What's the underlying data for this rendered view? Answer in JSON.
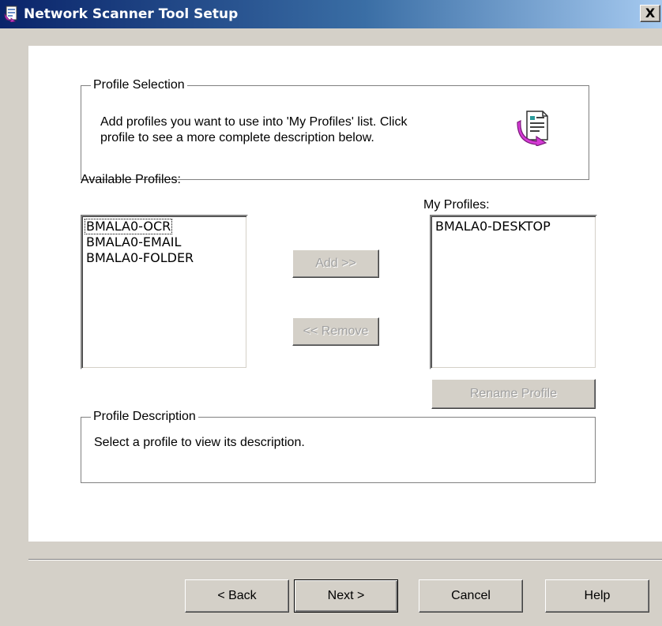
{
  "window": {
    "title": "Network Scanner Tool Setup",
    "title_icon": "setup-wizard-icon",
    "close_label": "X"
  },
  "profile_selection": {
    "legend": "Profile Selection",
    "description_line1": "Add profiles you want to use into 'My Profiles' list. Click",
    "description_line2": "profile to see a more complete description below.",
    "icon": "document-arrow-icon"
  },
  "available_profiles": {
    "label": "Available Profiles:",
    "items": [
      "BMALA0-OCR",
      "BMALA0-EMAIL",
      "BMALA0-FOLDER"
    ]
  },
  "my_profiles": {
    "label": "My Profiles:",
    "items": [
      "BMALA0-DESKTOP"
    ]
  },
  "buttons": {
    "add": "Add >>",
    "remove": "<< Remove",
    "rename": "Rename Profile",
    "back": "< Back",
    "next": "Next >",
    "cancel": "Cancel",
    "help": "Help"
  },
  "profile_description": {
    "legend": "Profile Description",
    "text": "Select a profile to view its description."
  },
  "colors": {
    "titlebar_start": "#0a246a",
    "titlebar_end": "#a6caf0",
    "dialog_face": "#d4d0c8",
    "panel_bg": "#ffffff",
    "disabled_text": "#a0a0a0"
  }
}
